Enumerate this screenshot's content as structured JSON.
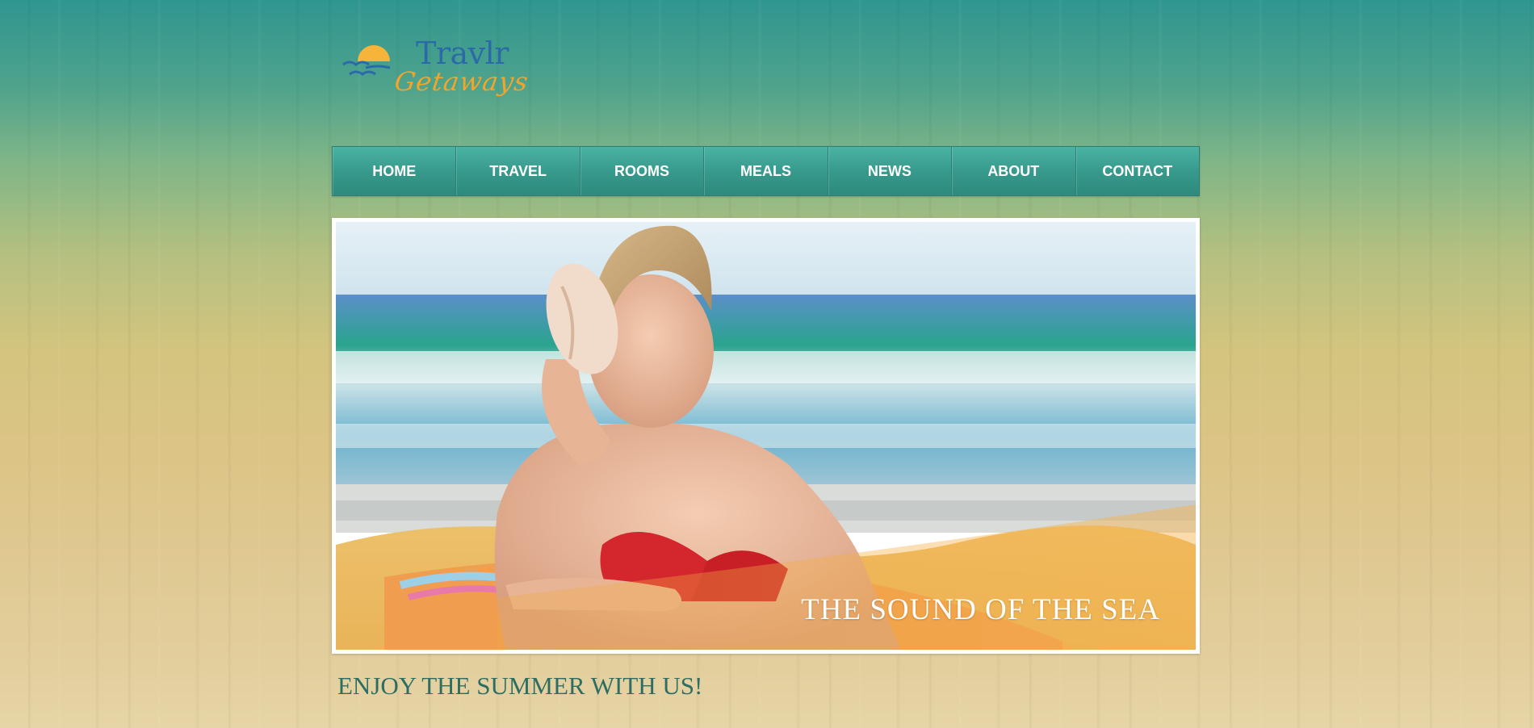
{
  "logo": {
    "line1": "Travlr",
    "line2": "Getaways",
    "sun_color": "#f6b43a",
    "bird_color": "#2a6aa8"
  },
  "nav": {
    "items": [
      {
        "label": "HOME"
      },
      {
        "label": "TRAVEL"
      },
      {
        "label": "ROOMS"
      },
      {
        "label": "MEALS"
      },
      {
        "label": "NEWS"
      },
      {
        "label": "ABOUT"
      },
      {
        "label": "CONTACT"
      }
    ],
    "color": "#3aa093"
  },
  "hero": {
    "caption": "THE SOUND OF THE SEA",
    "image_alt": "woman-listening-to-seashell-on-beach"
  },
  "tagline": "ENJOY THE SUMMER WITH US!"
}
